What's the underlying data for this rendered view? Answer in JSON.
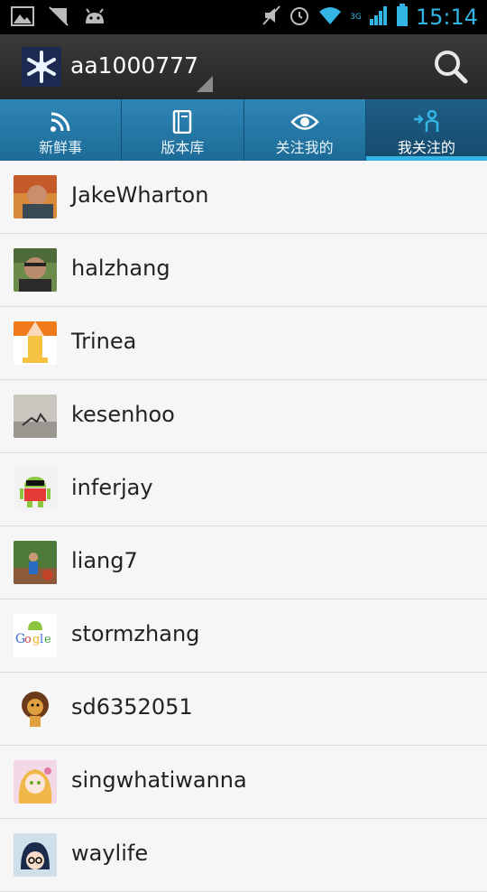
{
  "status_bar": {
    "time": "15:14",
    "network": "3G",
    "color": "#33b5e5"
  },
  "action_bar": {
    "username": "aa1000777",
    "search_icon": "search-icon",
    "background": "#2c2c2c"
  },
  "tabs": [
    {
      "label": "新鲜事",
      "icon": "rss-icon"
    },
    {
      "label": "版本库",
      "icon": "book-icon"
    },
    {
      "label": "关注我的",
      "icon": "eye-icon"
    },
    {
      "label": "我关注的",
      "icon": "follow-person-icon",
      "active": true
    }
  ],
  "following": [
    {
      "name": "JakeWharton",
      "avatar": "photo"
    },
    {
      "name": "halzhang",
      "avatar": "photo"
    },
    {
      "name": "Trinea",
      "avatar": "logo"
    },
    {
      "name": "kesenhoo",
      "avatar": "photo"
    },
    {
      "name": "inferjay",
      "avatar": "android-robot"
    },
    {
      "name": "liang7",
      "avatar": "photo"
    },
    {
      "name": "stormzhang",
      "avatar": "google-android"
    },
    {
      "name": "sd6352051",
      "avatar": "lion"
    },
    {
      "name": "singwhatiwanna",
      "avatar": "anime"
    },
    {
      "name": "waylife",
      "avatar": "anime"
    }
  ]
}
